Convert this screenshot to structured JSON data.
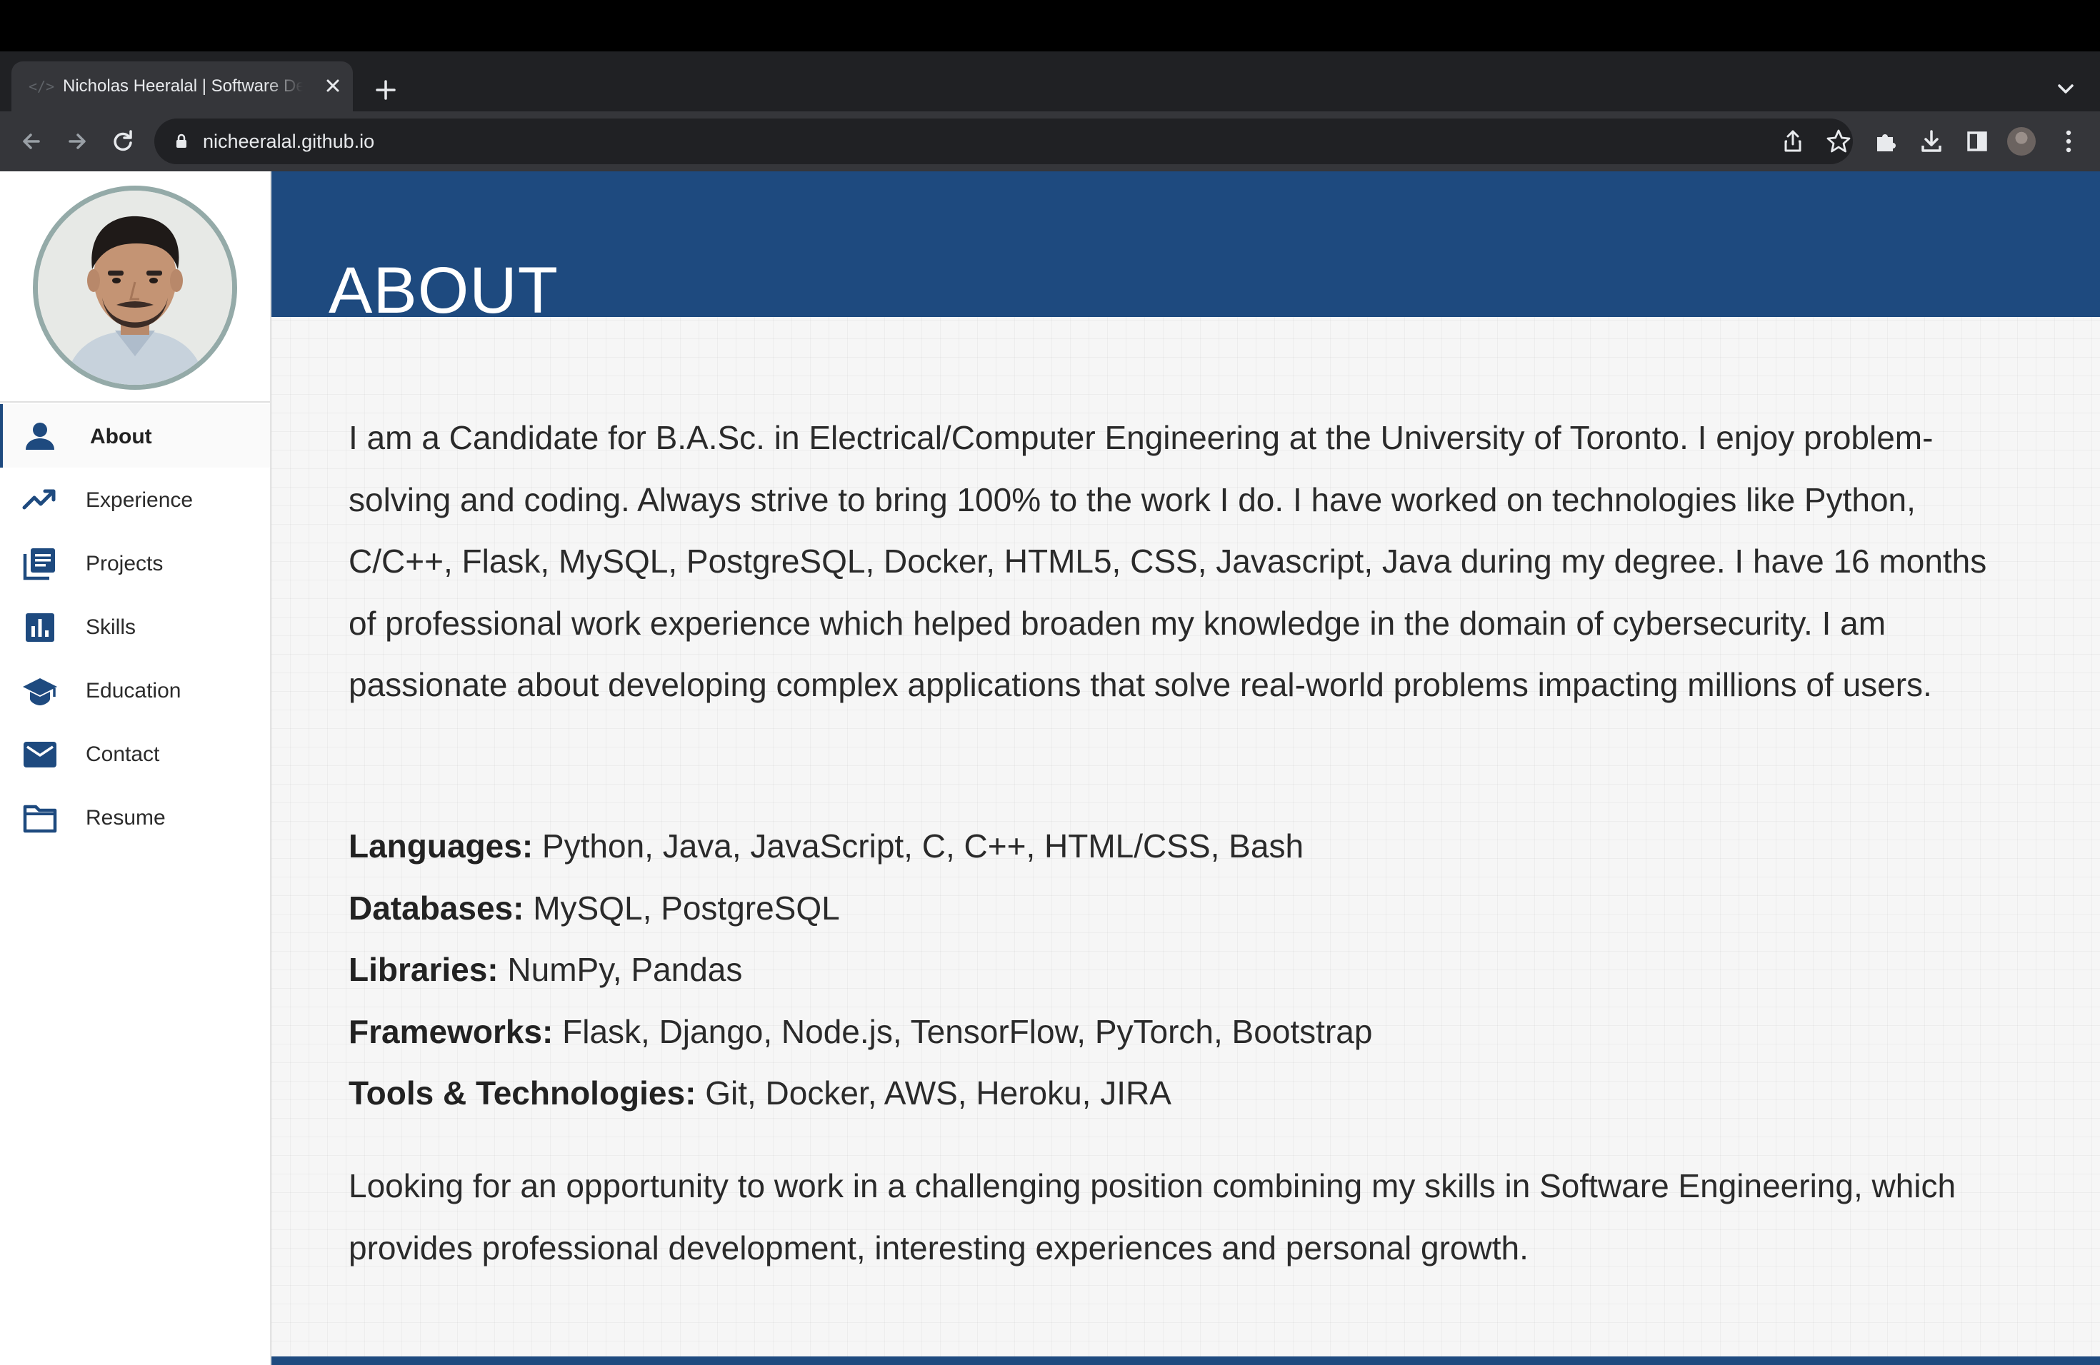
{
  "browser": {
    "tab_title": "Nicholas Heeralal | Software Developer",
    "url": "nicheeralal.github.io"
  },
  "sidebar": {
    "items": [
      {
        "label": "About",
        "icon": "person-icon",
        "active": true
      },
      {
        "label": "Experience",
        "icon": "trending-up-icon",
        "active": false
      },
      {
        "label": "Projects",
        "icon": "library-books-icon",
        "active": false
      },
      {
        "label": "Skills",
        "icon": "bar-chart-icon",
        "active": false
      },
      {
        "label": "Education",
        "icon": "school-icon",
        "active": false
      },
      {
        "label": "Contact",
        "icon": "mail-icon",
        "active": false
      },
      {
        "label": "Resume",
        "icon": "folder-icon",
        "active": false
      }
    ]
  },
  "main": {
    "title": "ABOUT",
    "intro": "I am a Candidate for B.A.Sc. in Electrical/Computer Engineering at the University of Toronto. I enjoy problem-solving and coding. Always strive to bring 100% to the work I do. I have worked on technologies like Python, C/C++, Flask, MySQL, PostgreSQL, Docker, HTML5, CSS, Javascript, Java during my degree. I have 16 months of professional work experience which helped broaden my knowledge in the domain of cybersecurity. I am passionate about developing complex applications that solve real-world problems impacting millions of users.",
    "skills": [
      {
        "label": "Languages:",
        "value": " Python, Java, JavaScript, C, C++, HTML/CSS, Bash"
      },
      {
        "label": "Databases:",
        "value": " MySQL, PostgreSQL"
      },
      {
        "label": "Libraries:",
        "value": " NumPy, Pandas"
      },
      {
        "label": "Frameworks:",
        "value": " Flask, Django, Node.js, TensorFlow, PyTorch, Bootstrap"
      },
      {
        "label": "Tools & Technologies:",
        "value": " Git, Docker, AWS, Heroku, JIRA"
      }
    ],
    "outro": "Looking for an opportunity to work in a challenging position combining my skills in Software Engineering, which provides professional development, interesting experiences and personal growth."
  },
  "colors": {
    "accent": "#1e4a7f",
    "chrome_dark": "#202124",
    "chrome_toolbar": "#35363a"
  }
}
